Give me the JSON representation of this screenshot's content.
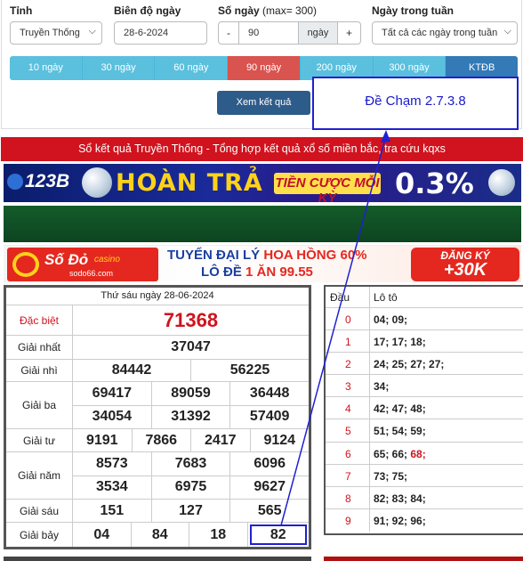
{
  "filters": {
    "province": {
      "label": "Tỉnh",
      "value": "Truyền Thống"
    },
    "date": {
      "label": "Biên độ ngày",
      "value": "28-6-2024"
    },
    "days": {
      "label": "Số ngày",
      "hint": "(max= 300)",
      "value": "90",
      "minus": "-",
      "unit": "ngày",
      "plus": "+"
    },
    "weekday": {
      "label": "Ngày trong tuần",
      "value": "Tất cả các ngày trong tuần"
    }
  },
  "ranges": [
    {
      "label": "10 ngày",
      "state": "normal"
    },
    {
      "label": "30 ngày",
      "state": "normal"
    },
    {
      "label": "60 ngày",
      "state": "normal"
    },
    {
      "label": "90 ngày",
      "state": "active"
    },
    {
      "label": "200 ngày",
      "state": "normal"
    },
    {
      "label": "300 ngày",
      "state": "normal"
    },
    {
      "label": "KTĐB",
      "state": "dark"
    }
  ],
  "view_button": "Xem kết quả",
  "annotation": "Đề Chạm 2.7.3.8",
  "title_bar": "Sổ kết quả Truyền Thống - Tổng hợp kết quả xổ số miền bắc, tra cứu kqxs",
  "banner1": {
    "brand": "123B",
    "headline": "HOÀN TRẢ",
    "sub": "TIỀN CƯỢC MỖI KỲ",
    "rate": "0.3%"
  },
  "banner3": {
    "brand": "Số Đỏ",
    "brand_tag": "casino",
    "site": "sodo66.com",
    "line1_a": "TUYỂN ĐẠI LÝ",
    "line1_b": "HOA HỒNG 60%",
    "line2_a": "LÔ ĐỀ",
    "line2_b": "1 ĂN 99.55",
    "cta_top": "ĐĂNG KÝ",
    "cta_bottom": "+30K"
  },
  "results": {
    "date": "Thứ sáu ngày 28-06-2024",
    "special": {
      "name": "Đặc biệt",
      "value": "71368"
    },
    "first": {
      "name": "Giải nhất",
      "value": "37047"
    },
    "second": {
      "name": "Giải nhì",
      "values": [
        "84442",
        "56225"
      ]
    },
    "third": {
      "name": "Giải ba",
      "values": [
        "69417",
        "89059",
        "36448",
        "34054",
        "31392",
        "57409"
      ]
    },
    "fourth": {
      "name": "Giải tư",
      "values": [
        "9191",
        "7866",
        "2417",
        "9124"
      ]
    },
    "fifth": {
      "name": "Giải năm",
      "values": [
        "8573",
        "7683",
        "6096",
        "3534",
        "6975",
        "9627"
      ]
    },
    "sixth": {
      "name": "Giải sáu",
      "values": [
        "151",
        "127",
        "565"
      ]
    },
    "seventh": {
      "name": "Giải bảy",
      "values": [
        "04",
        "84",
        "18",
        "82"
      ]
    }
  },
  "loto": {
    "head_label": "Đầu",
    "tail_label": "Lô tô",
    "rows": [
      {
        "head": "0",
        "values": "04; 09;"
      },
      {
        "head": "1",
        "values": "17; 17; 18;"
      },
      {
        "head": "2",
        "values": "24; 25; 27; 27;"
      },
      {
        "head": "3",
        "values": "34;"
      },
      {
        "head": "4",
        "values": "42; 47; 48;"
      },
      {
        "head": "5",
        "values": "51; 54; 59;"
      },
      {
        "head": "6",
        "values": "65; 66;",
        "highlight": "68;"
      },
      {
        "head": "7",
        "values": "73; 75;"
      },
      {
        "head": "8",
        "values": "82; 83; 84;"
      },
      {
        "head": "9",
        "values": "91; 92; 96;"
      }
    ]
  },
  "colors": {
    "accent_red": "#d0131e",
    "annotation_blue": "#2020d0",
    "range_blue": "#5bc0de",
    "view_button": "#2e5c8a"
  }
}
